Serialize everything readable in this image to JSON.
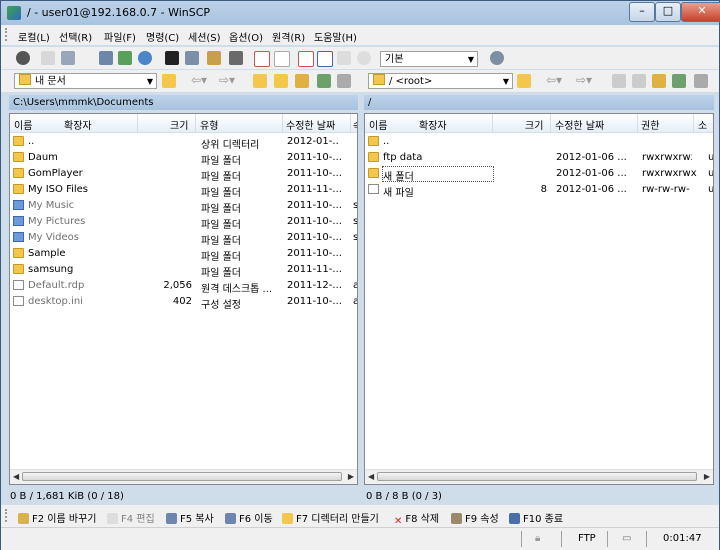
{
  "window": {
    "title": "/ - user01@192.168.0.7 - WinSCP"
  },
  "menu": [
    "로컬(L)",
    "선택(R)",
    "파일(F)",
    "명령(C)",
    "세션(S)",
    "옵션(O)",
    "원격(R)",
    "도움말(H)"
  ],
  "toolbar": {
    "preset": "기본"
  },
  "local": {
    "location": "내 문서",
    "path": "C:\\Users\\mmmk\\Documents",
    "columns": [
      "이름",
      "확장자",
      "크기",
      "유형",
      "수정한 날짜",
      "속"
    ],
    "rows": [
      {
        "name": "..",
        "size": "",
        "type": "상위 디렉터리",
        "date": "2012-01-..",
        "attr": "",
        "icon": "up-icon",
        "dim": false
      },
      {
        "name": "Daum",
        "size": "",
        "type": "파일 폴더",
        "date": "2011-10-...",
        "attr": "",
        "icon": "folder-icon",
        "dim": false
      },
      {
        "name": "GomPlayer",
        "size": "",
        "type": "파일 폴더",
        "date": "2011-10-...",
        "attr": "",
        "icon": "folder-icon",
        "dim": false
      },
      {
        "name": "My ISO Files",
        "size": "",
        "type": "파일 폴더",
        "date": "2011-11-...",
        "attr": "",
        "icon": "folder-icon",
        "dim": false
      },
      {
        "name": "My Music",
        "size": "",
        "type": "파일 폴더",
        "date": "2011-10-...",
        "attr": "s",
        "icon": "music-folder-icon",
        "dim": true
      },
      {
        "name": "My Pictures",
        "size": "",
        "type": "파일 폴더",
        "date": "2011-10-...",
        "attr": "s",
        "icon": "pictures-folder-icon",
        "dim": true
      },
      {
        "name": "My Videos",
        "size": "",
        "type": "파일 폴더",
        "date": "2011-10-...",
        "attr": "s",
        "icon": "videos-folder-icon",
        "dim": true
      },
      {
        "name": "Sample",
        "size": "",
        "type": "파일 폴더",
        "date": "2011-10-...",
        "attr": "",
        "icon": "folder-icon",
        "dim": false
      },
      {
        "name": "samsung",
        "size": "",
        "type": "파일 폴더",
        "date": "2011-11-...",
        "attr": "",
        "icon": "folder-icon",
        "dim": false
      },
      {
        "name": "Default.rdp",
        "size": "2,056",
        "type": "원격 데스크톱 ...",
        "date": "2011-12-...",
        "attr": "a",
        "icon": "rdp-file-icon",
        "dim": true
      },
      {
        "name": "desktop.ini",
        "size": "402",
        "type": "구성 설정",
        "date": "2011-10-...",
        "attr": "a",
        "icon": "ini-file-icon",
        "dim": true
      }
    ],
    "status": "0 B / 1,681 KiB (0 / 18)"
  },
  "remote": {
    "location": "/ <root>",
    "path": "/",
    "columns": [
      "이름",
      "확장자",
      "크기",
      "수정한 날짜",
      "권한",
      "소"
    ],
    "rows": [
      {
        "name": "..",
        "size": "",
        "date": "",
        "perm": "",
        "owner": "",
        "icon": "up-icon"
      },
      {
        "name": "ftp data",
        "size": "",
        "date": "2012-01-06 ...",
        "perm": "rwxrwxrwx",
        "owner": "u",
        "icon": "folder-icon"
      },
      {
        "name": "새 폴더",
        "size": "",
        "date": "2012-01-06 ...",
        "perm": "rwxrwxrwx",
        "owner": "u",
        "icon": "folder-icon"
      },
      {
        "name": "새 파일",
        "size": "8",
        "date": "2012-01-06 ...",
        "perm": "rw-rw-rw-",
        "owner": "u",
        "icon": "file-icon"
      }
    ],
    "status": "0 B / 8 B (0 / 3)"
  },
  "fkeys": [
    {
      "label": "F2 이름 바꾸기",
      "enabled": true
    },
    {
      "label": "F4 편집",
      "enabled": false
    },
    {
      "label": "F5 복사",
      "enabled": true
    },
    {
      "label": "F6 이동",
      "enabled": true
    },
    {
      "label": "F7 디렉터리 만들기",
      "enabled": true
    },
    {
      "label": "F8 삭제",
      "enabled": true
    },
    {
      "label": "F9 속성",
      "enabled": true
    },
    {
      "label": "F10 종료",
      "enabled": true
    }
  ],
  "statusbar": {
    "protocol": "FTP",
    "time": "0:01:47"
  }
}
